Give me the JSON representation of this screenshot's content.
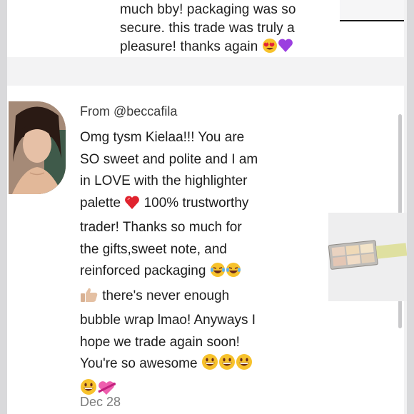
{
  "previous_review": {
    "lines": [
      "much bby! packaging was so",
      "secure. this trade was truly a",
      "pleasure! thanks again"
    ]
  },
  "review": {
    "from_prefix": "From",
    "username": "@beccafila",
    "lines": [
      "Omg tysm Kielaa!!! You are",
      "SO sweet and polite and I am",
      "in LOVE with the highlighter",
      [
        "palette ",
        " 100% trustworthy"
      ],
      "trader! Thanks so much for",
      "the gifts,sweet note, and",
      "reinforced packaging ",
      " there's never enough",
      "bubble wrap lmao! Anyways I",
      "hope we trade again soon!",
      "You're so awesome "
    ],
    "date": "Dec 28"
  },
  "emoji_icons": [
    "heart-eyes-icon",
    "purple-heart-icon",
    "red-heart-icon",
    "laughing-crying-icon",
    "thumbs-up-icon",
    "grinning-face-icon",
    "heart-with-ribbon-icon"
  ],
  "colors": {
    "text": "#1d1d1d",
    "date": "#7c7c7c",
    "background": "#f2f2f3"
  }
}
